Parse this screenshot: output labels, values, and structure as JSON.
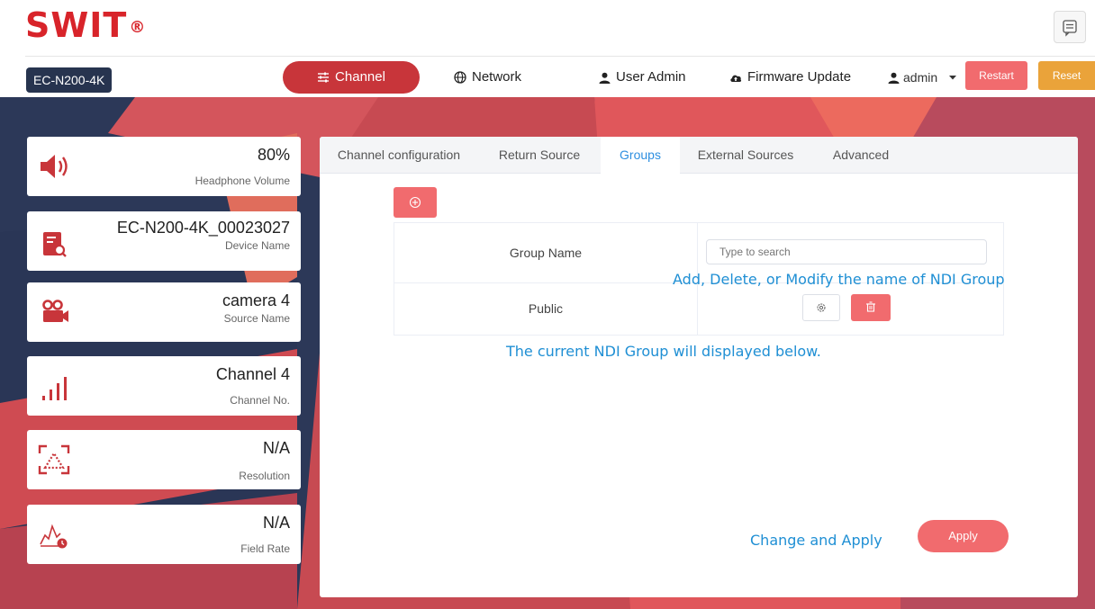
{
  "brand": {
    "logo_text": "SWIT",
    "reg_mark": "®"
  },
  "header": {
    "model": "EC-N200-4K",
    "nav": [
      {
        "label": "Channel",
        "icon": "sliders-icon",
        "active": true
      },
      {
        "label": "Network",
        "icon": "globe-icon"
      },
      {
        "label": "User Admin",
        "icon": "user-icon"
      },
      {
        "label": "Firmware Update",
        "icon": "cloud-upload-icon"
      }
    ],
    "user": "admin",
    "restart_label": "Restart",
    "reset_label": "Reset"
  },
  "status_cards": [
    {
      "value": "80%",
      "label": "Headphone Volume",
      "icon": "speaker-icon"
    },
    {
      "value": "EC-N200-4K_00023027",
      "label": "Device Name",
      "icon": "device-doc-icon"
    },
    {
      "value": "camera 4",
      "label": "Source Name",
      "icon": "video-camera-icon"
    },
    {
      "value": "Channel 4",
      "label": "Channel No.",
      "icon": "signal-bars-icon"
    },
    {
      "value": "N/A",
      "label": "Resolution",
      "icon": "resolution-icon"
    },
    {
      "value": "N/A",
      "label": "Field Rate",
      "icon": "field-rate-icon"
    }
  ],
  "tabs": [
    {
      "label": "Channel configuration"
    },
    {
      "label": "Return Source"
    },
    {
      "label": "Groups",
      "active": true
    },
    {
      "label": "External Sources"
    },
    {
      "label": "Advanced"
    }
  ],
  "groups": {
    "header_label": "Group Name",
    "search_placeholder": "Type to search",
    "rows": [
      {
        "name": "Public"
      }
    ]
  },
  "annotations": {
    "modify": "Add, Delete, or Modify the name of NDI Group",
    "current": "The current NDI Group will displayed below.",
    "apply": "Change and Apply"
  },
  "apply_label": "Apply",
  "colors": {
    "brand_red": "#d8242a",
    "accent_red": "#f16b6e",
    "nav_active": "#c8353a",
    "reset_orange": "#eaa33a",
    "navy": "#27344f",
    "annotation_blue": "#1f8fd4",
    "tab_active_blue": "#2e8fe0"
  }
}
